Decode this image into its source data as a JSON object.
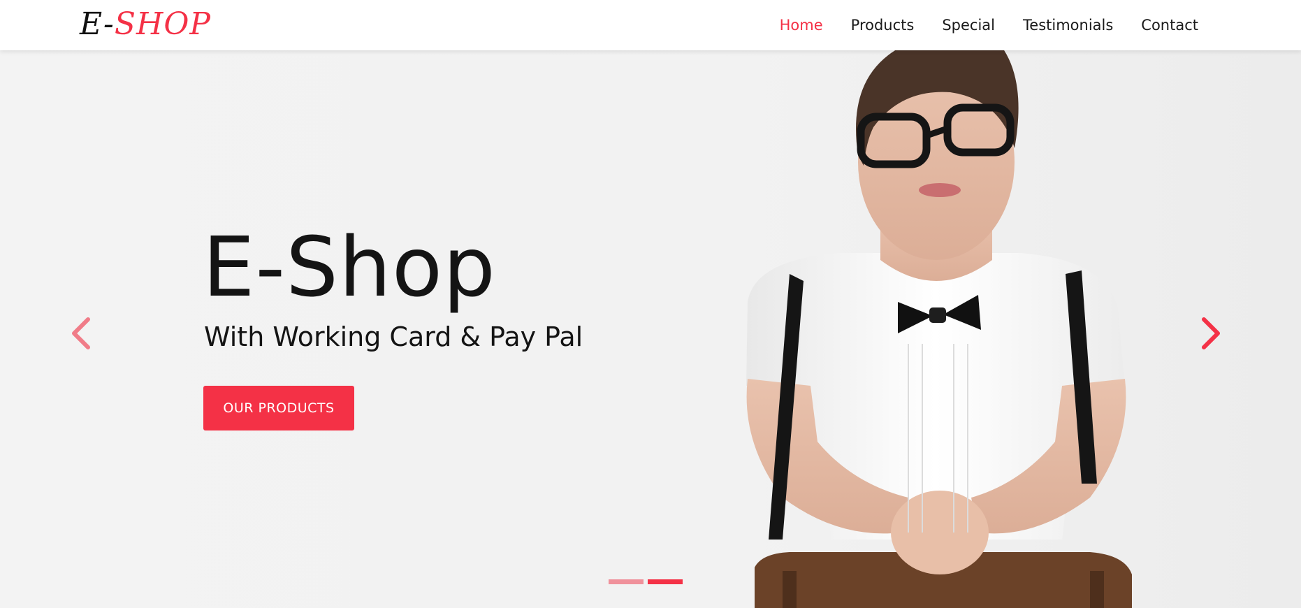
{
  "brand": {
    "logo_part1": "E-",
    "logo_part2": "SHOP",
    "accent_color": "#f43146"
  },
  "nav": {
    "items": [
      {
        "label": "Home",
        "active": true
      },
      {
        "label": "Products",
        "active": false
      },
      {
        "label": "Special",
        "active": false
      },
      {
        "label": "Testimonials",
        "active": false
      },
      {
        "label": "Contact",
        "active": false
      }
    ]
  },
  "hero": {
    "title": "E-Shop",
    "subtitle": "With Working Card & Pay Pal",
    "cta_label": "OUR PRODUCTS",
    "prev_icon": "chevron-left-icon",
    "next_icon": "chevron-right-icon",
    "slides": [
      {
        "active": false
      },
      {
        "active": true
      }
    ]
  }
}
